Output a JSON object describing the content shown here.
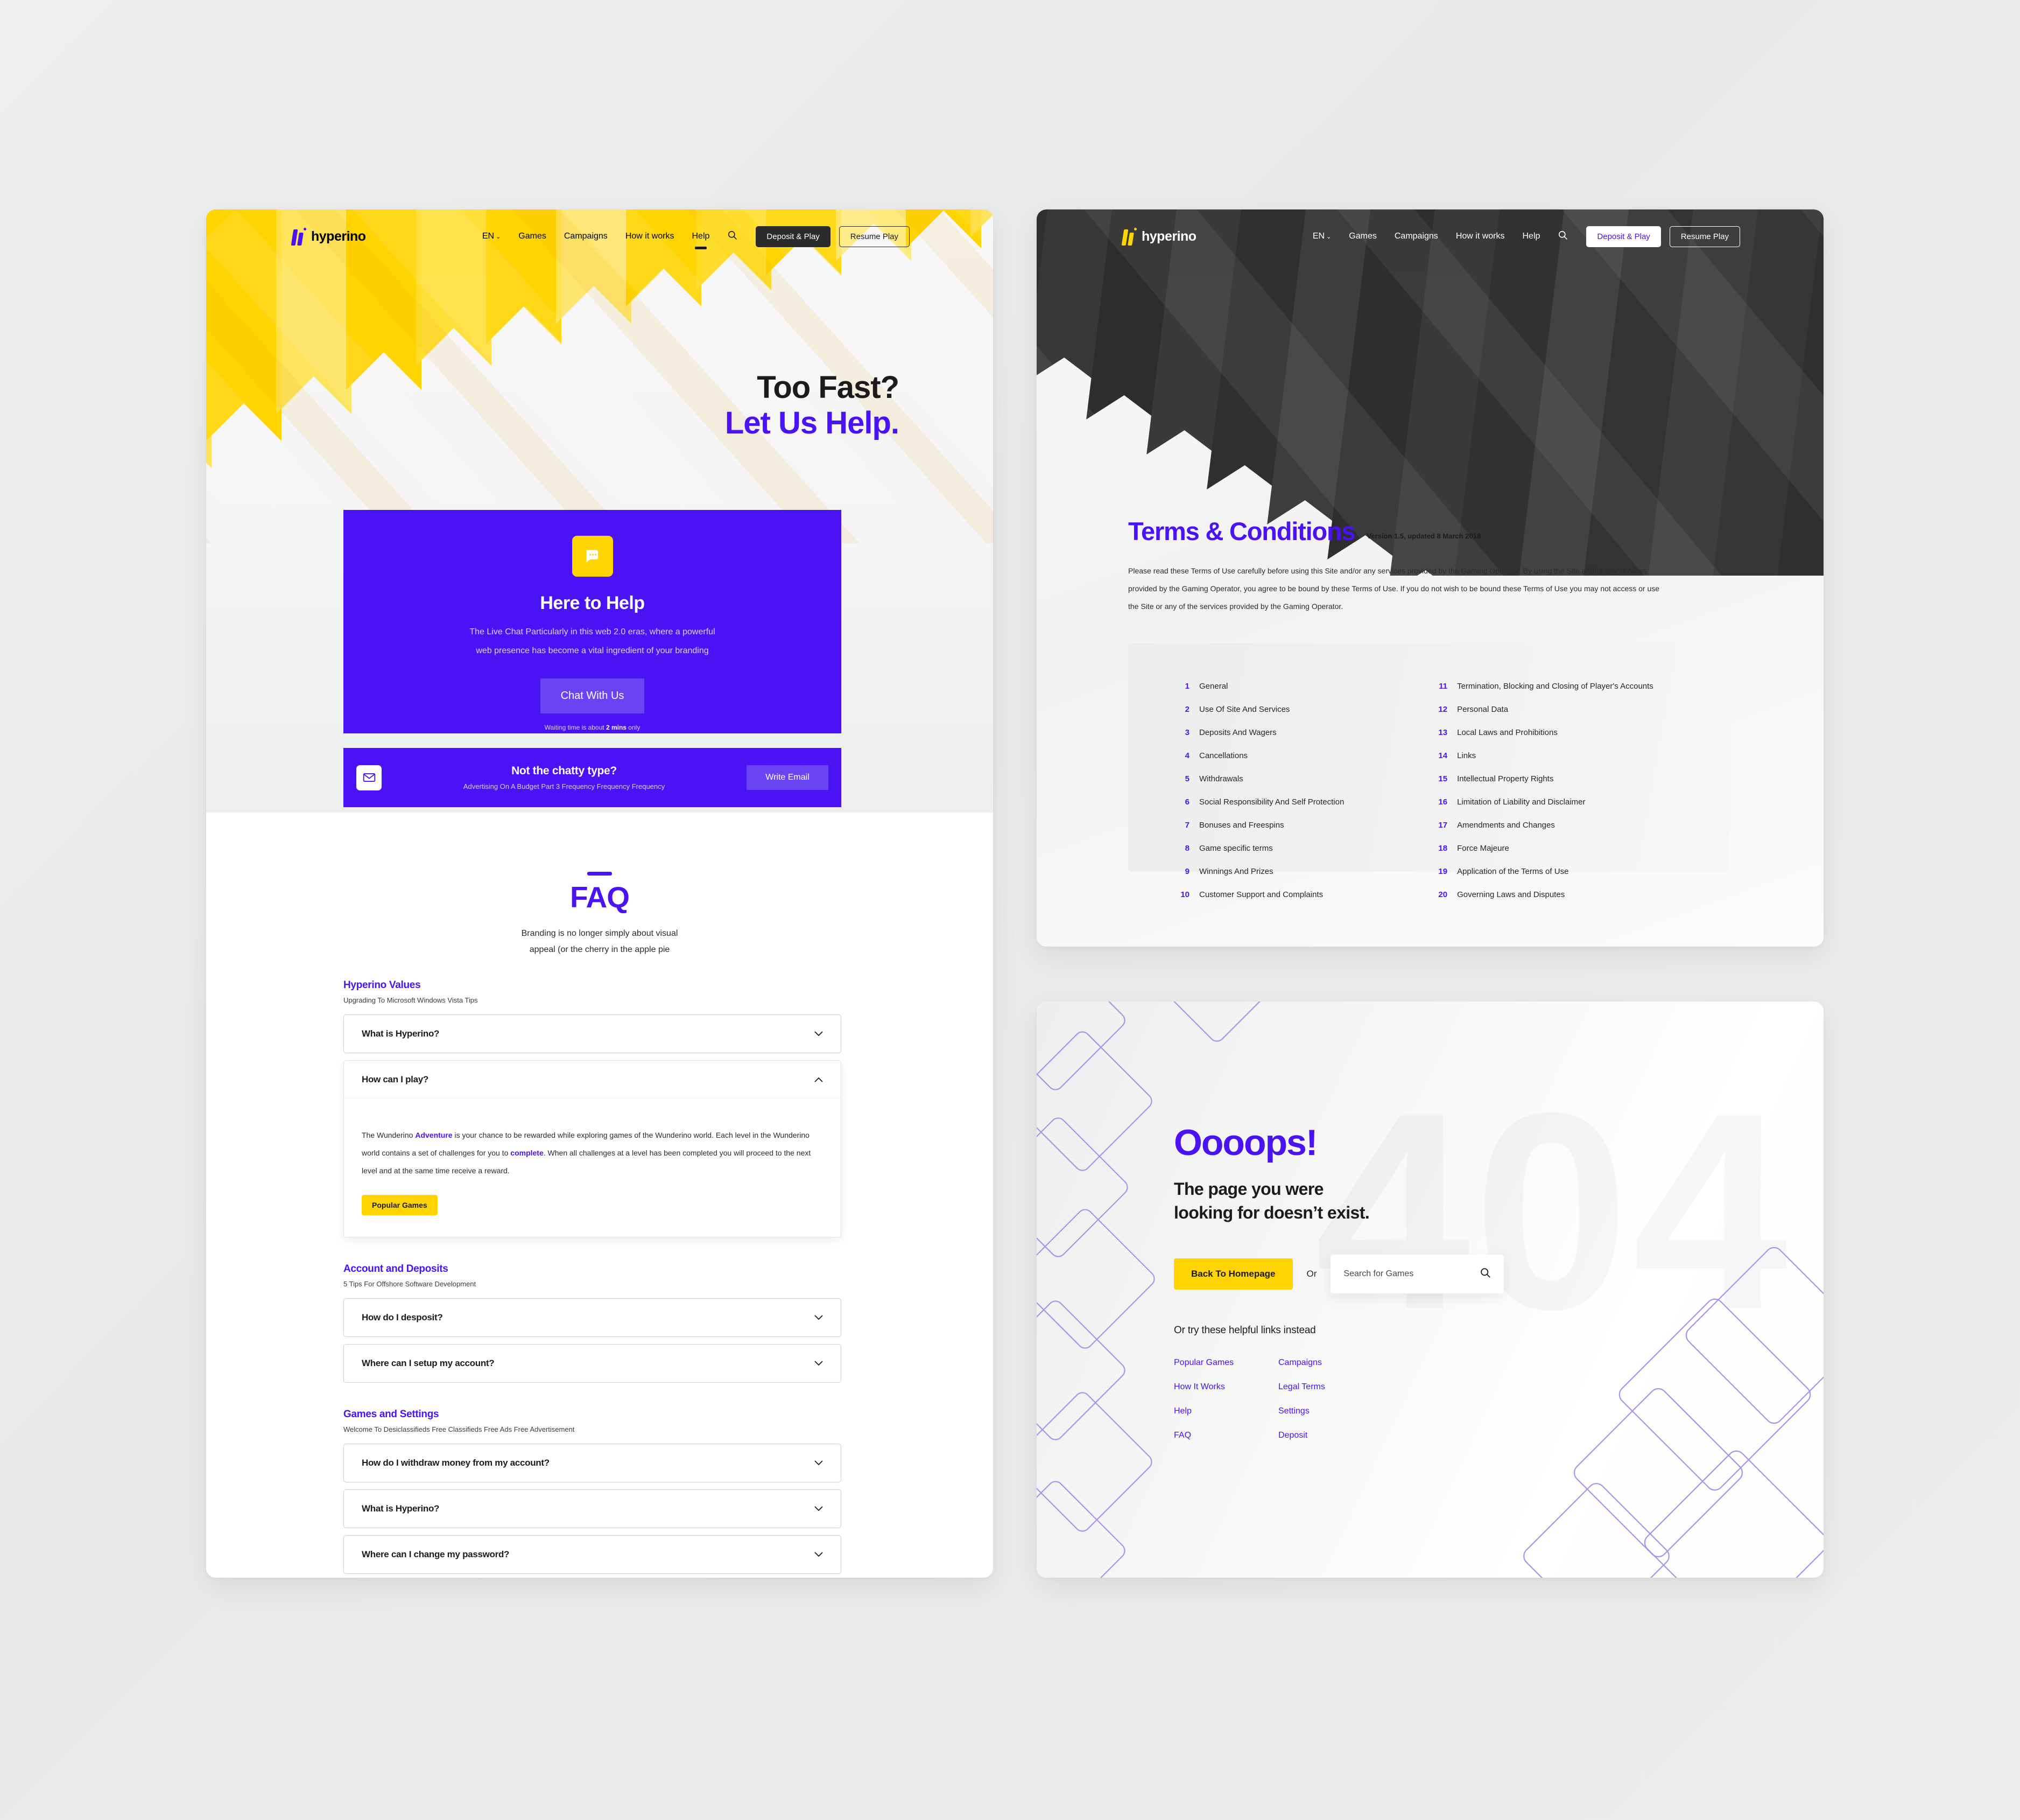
{
  "brand": {
    "name": "hyperino",
    "accent": "#4b12f5",
    "yellow": "#ffd400",
    "dark": "#2b2b2b"
  },
  "nav": {
    "lang": "EN",
    "caret": "⌄",
    "links": [
      "Games",
      "Campaigns",
      "How it works",
      "Help"
    ],
    "search_icon": "search-icon",
    "deposit_label": "Deposit & Play",
    "resume_label": "Resume Play"
  },
  "help": {
    "hero": {
      "line1": "Too Fast?",
      "line2": "Let Us Help."
    },
    "chat": {
      "icon": "chat-bubble-icon",
      "title": "Here to Help",
      "body_line1": "The Live Chat Particularly in this web 2.0 eras, where a powerful",
      "body_line2": "web presence has become a vital ingredient of your branding",
      "button": "Chat With Us",
      "note_prefix": "Waiting time is about ",
      "note_strong": "2 mins",
      "note_suffix": " only"
    },
    "email": {
      "icon": "envelope-icon",
      "title": "Not the chatty type?",
      "subtitle": "Advertising On A Budget Part 3 Frequency Frequency Frequency",
      "button": "Write  Email"
    },
    "faq": {
      "title": "FAQ",
      "sub_line1": "Branding is no longer simply about visual",
      "sub_line2": "appeal (or the cherry in the apple pie",
      "groups": [
        {
          "title": "Hyperino Values",
          "subtitle": "Upgrading To Microsoft Windows Vista Tips",
          "items": [
            {
              "q": "What is Hyperino?",
              "open": false
            },
            {
              "q": "How can I play?",
              "open": true,
              "answer_1": "The Wunderino ",
              "answer_link_1": "Adventure",
              "answer_2": " is your chance to be rewarded while exploring games of the Wunderino world. Each level in the Wunderino world contains a set of challenges for you to ",
              "answer_link_2": "complete",
              "answer_3": ". When all challenges at a level has been completed you will proceed to the next level and at the same time receive a reward.",
              "tag": "Popular Games"
            }
          ]
        },
        {
          "title": "Account and Deposits",
          "subtitle": "5 Tips For Offshore Software Development",
          "items": [
            {
              "q": "How do I desposit?",
              "open": false
            },
            {
              "q": "Where can I setup my account?",
              "open": false
            }
          ]
        },
        {
          "title": "Games and Settings",
          "subtitle": "Welcome To Desiclassifieds Free Classifieds Free Ads Free Advertisement",
          "items": [
            {
              "q": "How do I withdraw money from my account?",
              "open": false
            },
            {
              "q": "What is Hyperino?",
              "open": false
            },
            {
              "q": "Where can I change my password?",
              "open": false
            }
          ]
        }
      ]
    }
  },
  "terms": {
    "title": "Terms & Conditions",
    "version": "Version 1.5, updated 8 March 2018",
    "intro": "Please read these Terms of Use carefully before using this Site and/or any services provided by the Gaming Operator. By using the Site and/or any services provided by the Gaming Operator, you agree to be bound by these Terms of Use. If you do not wish to be bound these Terms of Use you may not access or use the Site or any of the services provided by the Gaming Operator.",
    "index_left": [
      {
        "n": "1",
        "label": "General"
      },
      {
        "n": "2",
        "label": "Use Of Site And Services"
      },
      {
        "n": "3",
        "label": "Deposits And Wagers"
      },
      {
        "n": "4",
        "label": "Cancellations"
      },
      {
        "n": "5",
        "label": "Withdrawals"
      },
      {
        "n": "6",
        "label": "Social Responsibility And Self Protection"
      },
      {
        "n": "7",
        "label": "Bonuses and Freespins"
      },
      {
        "n": "8",
        "label": "Game specific terms"
      },
      {
        "n": "9",
        "label": "Winnings And Prizes"
      },
      {
        "n": "10",
        "label": "Customer Support and Complaints"
      }
    ],
    "index_right": [
      {
        "n": "11",
        "label": "Termination, Blocking and Closing of Player's Accounts"
      },
      {
        "n": "12",
        "label": "Personal Data"
      },
      {
        "n": "13",
        "label": "Local Laws and Prohibitions"
      },
      {
        "n": "14",
        "label": "Links"
      },
      {
        "n": "15",
        "label": "Intellectual Property Rights"
      },
      {
        "n": "16",
        "label": "Limitation of Liability and Disclaimer"
      },
      {
        "n": "17",
        "label": "Amendments and Changes"
      },
      {
        "n": "18",
        "label": "Force Majeure"
      },
      {
        "n": "19",
        "label": "Application of the Terms of Use"
      },
      {
        "n": "20",
        "label": "Governing Laws and Disputes"
      }
    ]
  },
  "notfound": {
    "ghost": "404",
    "oops": "Oooops!",
    "sub_line1": "The page you were",
    "sub_line2": "looking for doesn’t exist.",
    "home_button": "Back To Homepage",
    "or": "Or",
    "search_placeholder": "Search for Games",
    "search_value": "",
    "search_icon": "search-icon",
    "helpful_label": "Or try these helpful links instead",
    "links": [
      "Popular Games",
      "Campaigns",
      "How It Works",
      "Legal Terms",
      "Help",
      "Settings",
      "FAQ",
      "Deposit"
    ]
  }
}
